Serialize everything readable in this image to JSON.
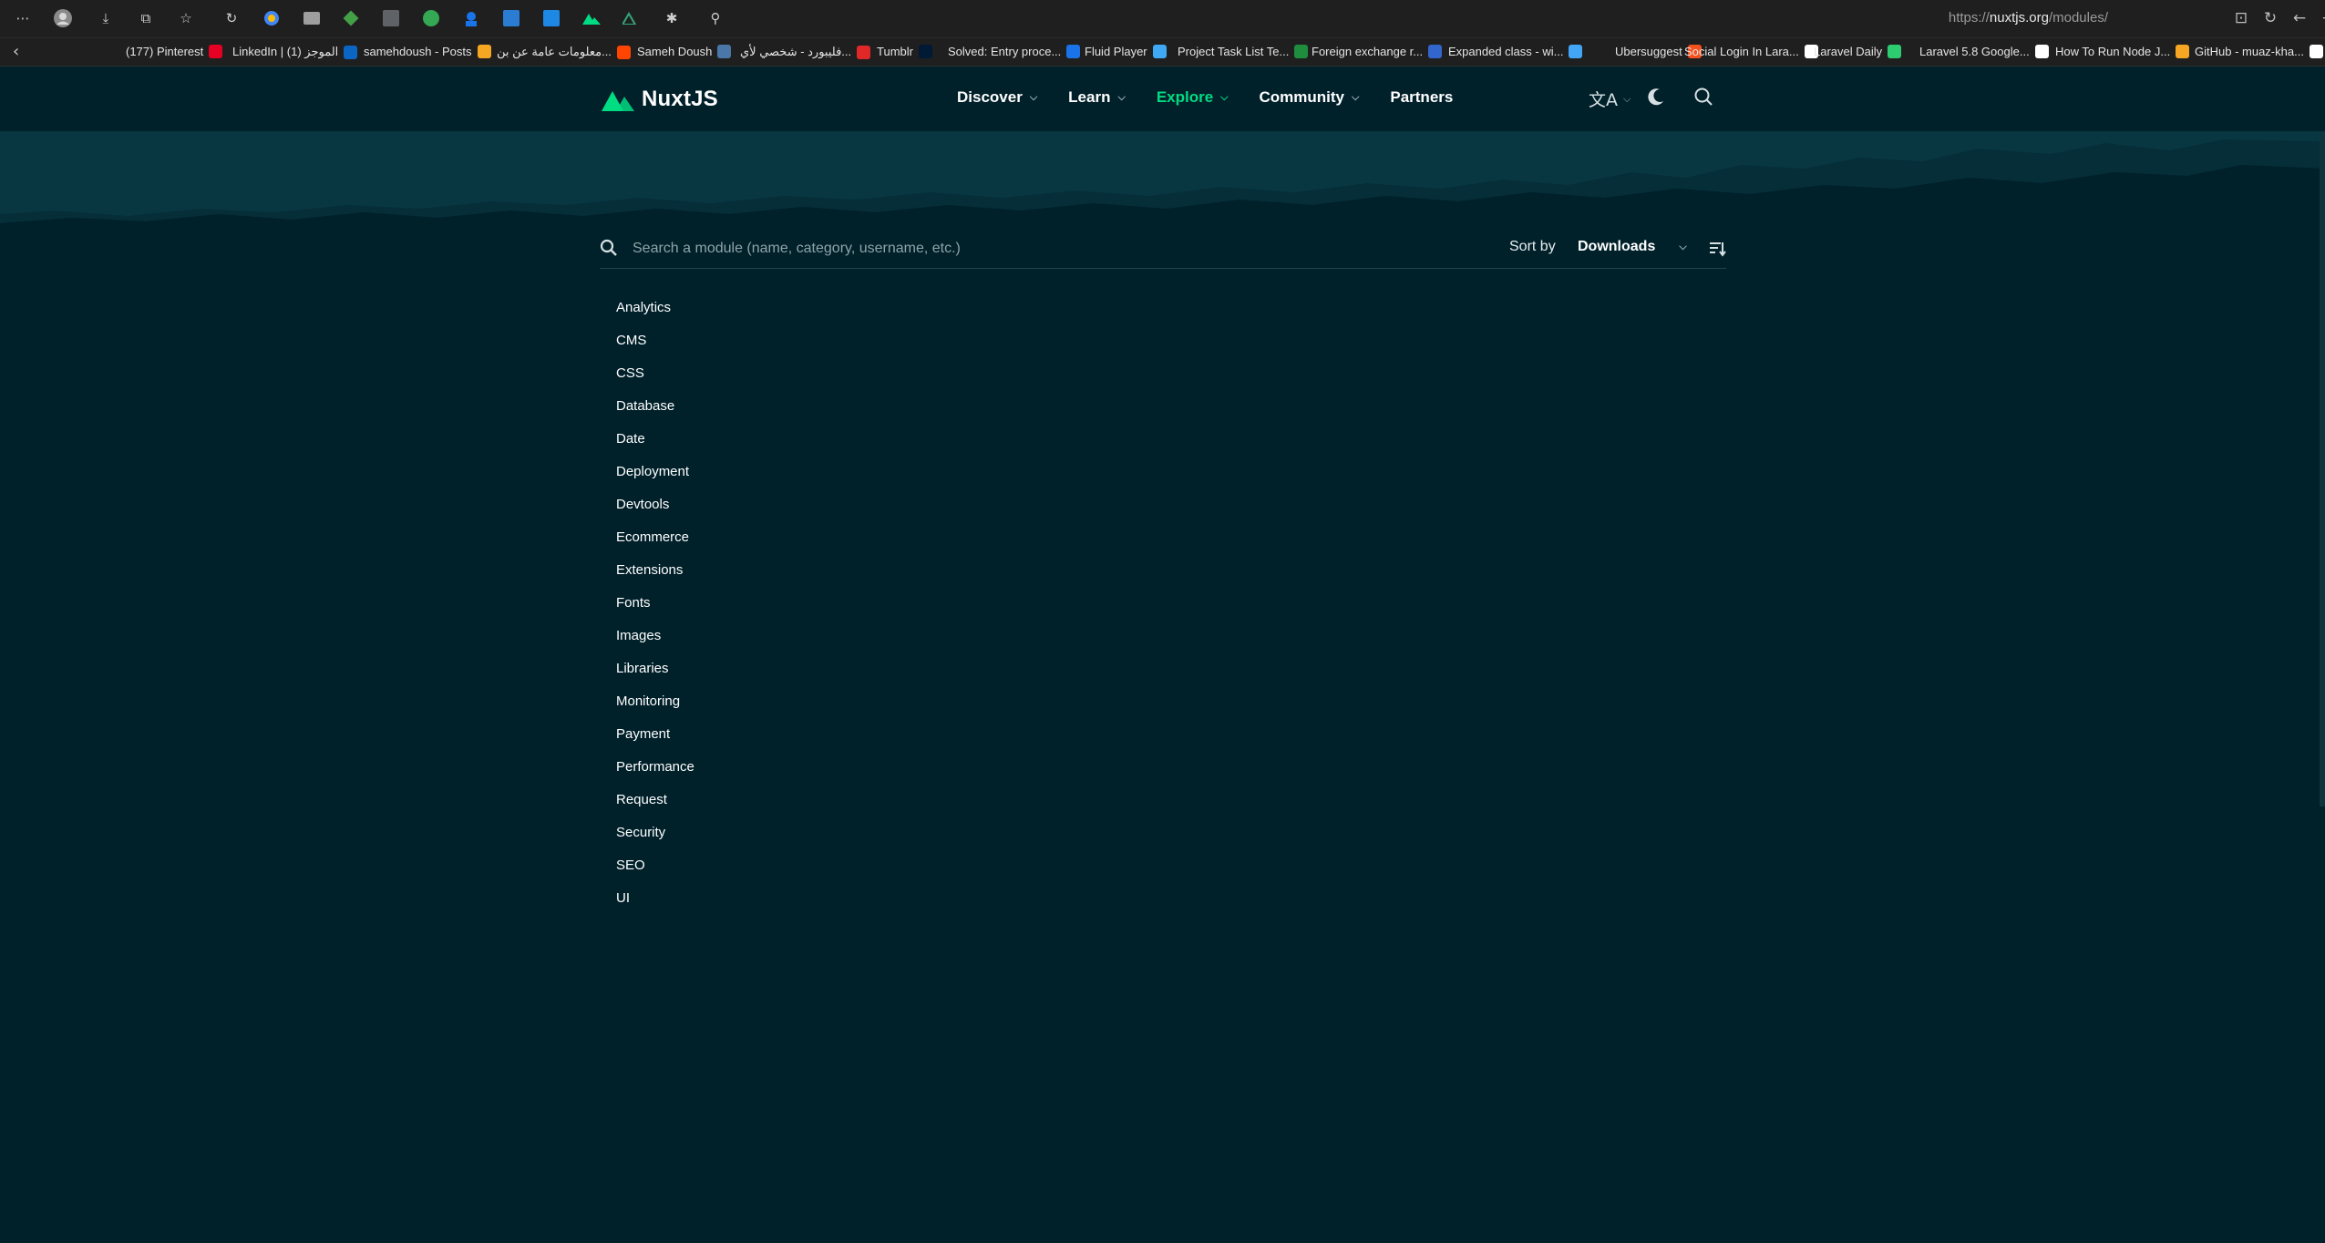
{
  "browser": {
    "url_prefix": "https://",
    "url_host": "nuxtjs.org",
    "url_path": "/modules/",
    "bookmarks": [
      {
        "label": "(177) Pinterest",
        "color": "#e60023"
      },
      {
        "label": "LinkedIn | الموجز (1)",
        "color": "#0a66c2"
      },
      {
        "label": "samehdoush - Posts",
        "color": "#f6a623"
      },
      {
        "label": "معلومات عامة عن بن...",
        "color": "#ff4500"
      },
      {
        "label": "Sameh Doush",
        "color": "#4a76a8"
      },
      {
        "label": "فليبورد - شخصي لأي...",
        "color": "#e12828"
      },
      {
        "label": "Tumblr",
        "color": "#001935"
      },
      {
        "label": "Solved: Entry proce...",
        "color": "#1a73e8"
      },
      {
        "label": "Fluid Player",
        "color": "#3fa9f5"
      },
      {
        "label": "Project Task List Te...",
        "color": "#1e8e3e"
      },
      {
        "label": "Foreign exchange r...",
        "color": "#3366cc"
      },
      {
        "label": "Expanded class - wi...",
        "color": "#42a5f5"
      },
      {
        "label": "Ubersuggest",
        "color": "#f4511e"
      },
      {
        "label": "Social Login In Lara...",
        "color": "#ffffff"
      },
      {
        "label": "Laravel Daily",
        "color": "#2ecc71"
      },
      {
        "label": "Laravel 5.8 Google...",
        "color": "#ffffff"
      },
      {
        "label": "How To Run Node J...",
        "color": "#f5a623"
      },
      {
        "label": "GitHub - muaz-kha...",
        "color": "#ffffff"
      }
    ]
  },
  "header": {
    "logo_text": "NuxtJS",
    "nav": [
      {
        "label": "Discover"
      },
      {
        "label": "Learn"
      },
      {
        "label": "Explore"
      },
      {
        "label": "Community"
      },
      {
        "label": "Partners"
      }
    ],
    "accent_color": "#00dc82"
  },
  "search": {
    "placeholder": "Search a module (name, category, username, etc.)",
    "sort_label": "Sort by",
    "sort_value": "Downloads"
  },
  "categories": [
    "Analytics",
    "CMS",
    "CSS",
    "Database",
    "Date",
    "Deployment",
    "Devtools",
    "Ecommerce",
    "Extensions",
    "Fonts",
    "Images",
    "Libraries",
    "Monitoring",
    "Payment",
    "Performance",
    "Request",
    "Security",
    "SEO",
    "UI"
  ]
}
